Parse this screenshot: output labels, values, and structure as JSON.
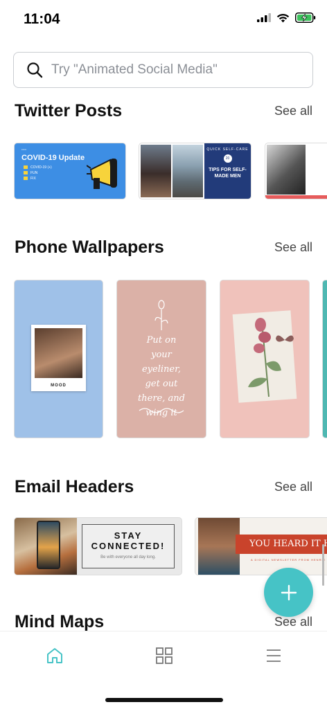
{
  "status": {
    "time": "11:04"
  },
  "search": {
    "placeholder": "Try \"Animated Social Media\""
  },
  "sections": [
    {
      "title": "Twitter Posts",
      "see_all": "See all"
    },
    {
      "title": "Phone Wallpapers",
      "see_all": "See all"
    },
    {
      "title": "Email Headers",
      "see_all": "See all"
    },
    {
      "title": "Mind Maps",
      "see_all": "See all"
    }
  ],
  "twitter": {
    "covid_title": "COVID-19 Update",
    "covid_items": [
      "COVID-19 (+)",
      "FUN",
      "FIX"
    ],
    "tips_title": "TIPS FOR SELF-MADE MEN",
    "tips_top": "QUICK SELF-CARE",
    "tips_badge": "20"
  },
  "wallpapers": {
    "mood": "MOOD",
    "quote": "Put on your eyeliner, get out there, and wing it"
  },
  "email": {
    "stay": "STAY CONNECTED!",
    "stay_sub": "Be with everyone all day long.",
    "heard": "YOU HEARD IT H",
    "heard_sub": "A DIGITAL NEWSLETTER FROM HENRIE"
  },
  "nav": {
    "tabs": [
      {
        "name": "home",
        "icon": "home-icon",
        "active": true
      },
      {
        "name": "designs",
        "icon": "grid-icon",
        "active": false
      },
      {
        "name": "menu",
        "icon": "menu-icon",
        "active": false
      }
    ]
  },
  "colors": {
    "accent": "#46c3c6",
    "twitter_blue": "#3d8ee4",
    "navy": "#223b7a",
    "red": "#c9432b"
  }
}
